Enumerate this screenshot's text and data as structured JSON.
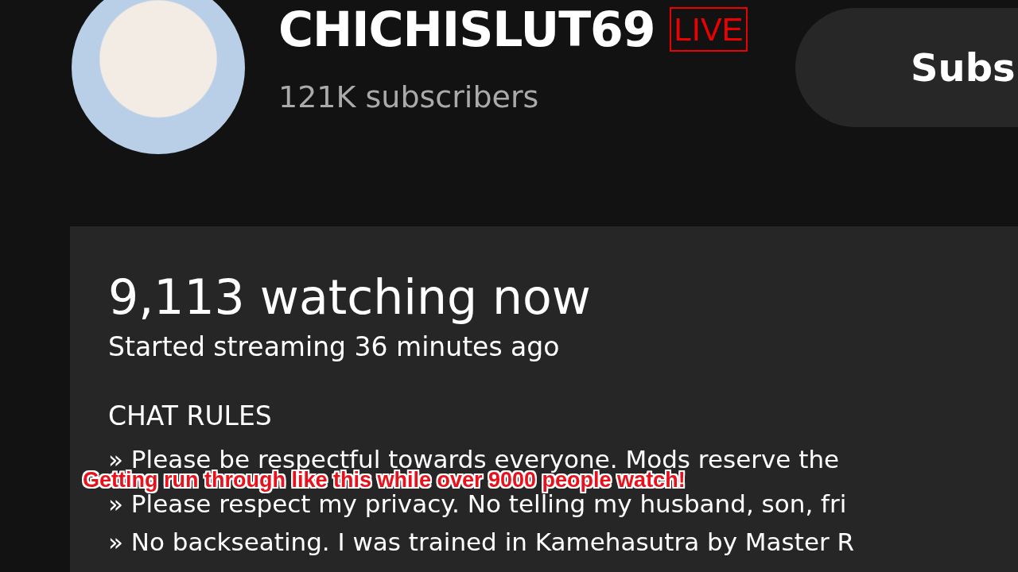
{
  "channel": {
    "name": "CHICHISLUT69",
    "badge": "LIVE",
    "subscribers": "121K subscribers",
    "subscribe_button": "Subs"
  },
  "stream": {
    "watching": "9,113 watching now",
    "started": "Started streaming 36 minutes ago"
  },
  "rules": {
    "heading": "CHAT RULES",
    "items": [
      "» Please be respectful towards everyone. Mods reserve the",
      "» Please respect my privacy. No telling my husband, son, fri",
      "» No backseating. I was trained in Kamehasutra by Master R"
    ]
  },
  "caption": "Getting run through like this while over 9000 people watch!"
}
